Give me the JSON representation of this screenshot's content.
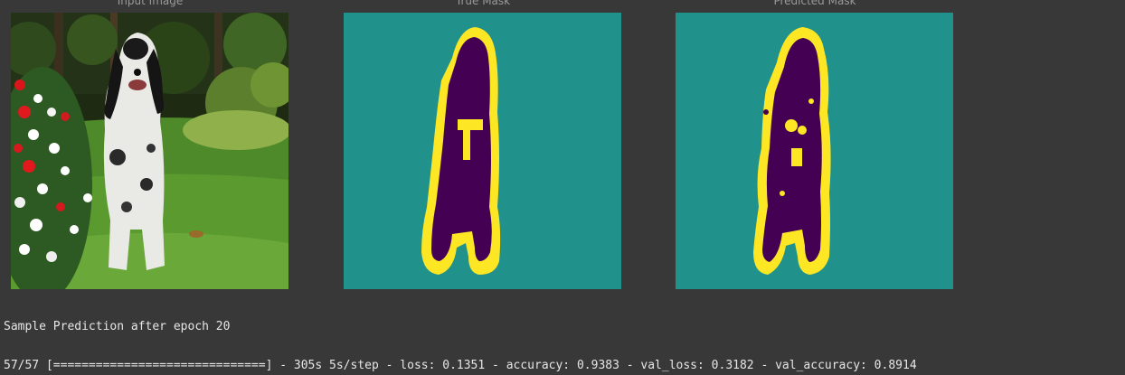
{
  "titles": {
    "input": "Input Image",
    "true_mask": "True Mask",
    "predicted_mask": "Predicted Mask"
  },
  "colors": {
    "background": "#383838",
    "mask_background": "#21918c",
    "mask_border": "#fde725",
    "mask_object": "#440154"
  },
  "output": {
    "sample_prediction": "Sample Prediction after epoch 20",
    "progress": "57/57 [==============================] - 305s 5s/step - loss: 0.1351 - accuracy: 0.9383 - val_loss: 0.3182 - val_accuracy: 0.8914"
  }
}
